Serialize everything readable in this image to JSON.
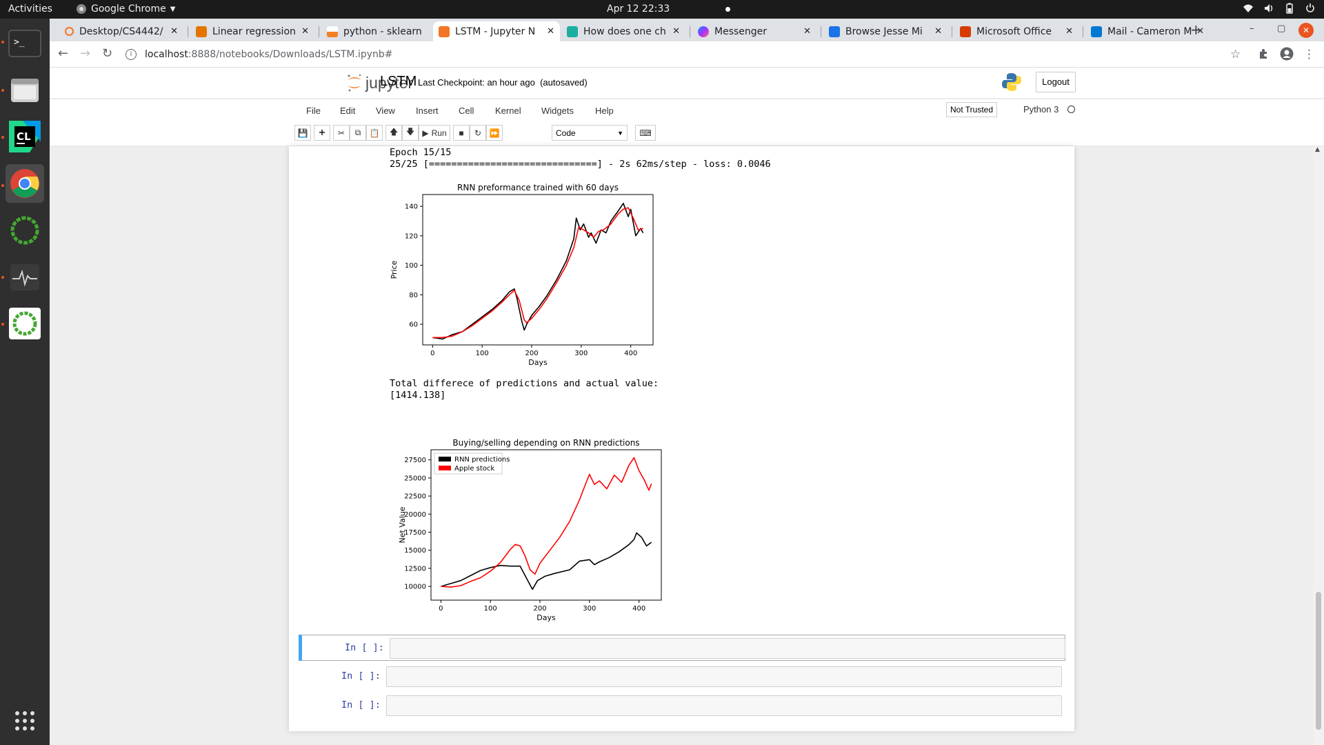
{
  "system_bar": {
    "activities": "Activities",
    "app_menu": "Google Chrome",
    "clock": "Apr 12  22:33",
    "tray_icons": [
      "wifi-icon",
      "volume-icon",
      "battery-icon",
      "power-menu-icon"
    ]
  },
  "dock": {
    "items": [
      {
        "name": "terminal",
        "running": true
      },
      {
        "name": "files",
        "running": true
      },
      {
        "name": "clion",
        "running": true
      },
      {
        "name": "chrome",
        "running": true,
        "active": true
      },
      {
        "name": "anaconda-navigator",
        "running": false
      },
      {
        "name": "system-monitor",
        "running": true
      },
      {
        "name": "anaconda",
        "running": true
      }
    ],
    "apps_grid": "show-applications-icon"
  },
  "browser": {
    "tabs": [
      {
        "label": "Desktop/CS4442/",
        "favicon": "jupyter",
        "color": "#f37626"
      },
      {
        "label": "Linear regression",
        "favicon": "doc",
        "color": "#e37400"
      },
      {
        "label": "python - sklearn",
        "favicon": "stackoverflow",
        "color": "#f48024"
      },
      {
        "label": "LSTM - Jupyter N",
        "favicon": "jupyter",
        "color": "#f37626",
        "active": true
      },
      {
        "label": "How does one ch",
        "favicon": "r",
        "color": "#1aafa0"
      },
      {
        "label": "Messenger",
        "favicon": "messenger",
        "color": "#a033ff"
      },
      {
        "label": "Browse Jesse Mi",
        "favicon": "bookmark",
        "color": "#1a73e8"
      },
      {
        "label": "Microsoft Office",
        "favicon": "office",
        "color": "#d83b01"
      },
      {
        "label": "Mail - Cameron M",
        "favicon": "outlook",
        "color": "#0078d4"
      }
    ],
    "url_host": "localhost",
    "url_path": ":8888/notebooks/Downloads/LSTM.ipynb#"
  },
  "jupyter": {
    "logo_text": "jupyter",
    "notebook_name": "LSTM",
    "checkpoint": "Last Checkpoint: an hour ago",
    "autosaved": "(autosaved)",
    "logout": "Logout",
    "menu": [
      "File",
      "Edit",
      "View",
      "Insert",
      "Cell",
      "Kernel",
      "Widgets",
      "Help"
    ],
    "trust": "Not Trusted",
    "kernel": "Python 3",
    "toolbar": {
      "run": "Run",
      "cell_type": "Code"
    }
  },
  "outputs": {
    "epoch_line": "Epoch 15/15",
    "progress_line": "25/25 [==============================] - 2s 62ms/step - loss: 0.0046",
    "diff_label": "Total differece of predictions and actual value:",
    "diff_value": "[1414.138]"
  },
  "cells": [
    {
      "prompt": "In [ ]:"
    },
    {
      "prompt": "In [ ]:"
    },
    {
      "prompt": "In [ ]:"
    }
  ],
  "chart_data": [
    {
      "type": "line",
      "title": "RNN preformance trained with 60 days",
      "xlabel": "Days",
      "ylabel": "Price",
      "xlim": [
        -20,
        445
      ],
      "ylim": [
        46,
        148
      ],
      "xticks": [
        0,
        100,
        200,
        300,
        400
      ],
      "yticks": [
        60,
        80,
        100,
        120,
        140
      ],
      "series": [
        {
          "color": "#000000",
          "x": [
            0,
            20,
            40,
            60,
            80,
            100,
            120,
            140,
            155,
            165,
            170,
            180,
            185,
            190,
            200,
            215,
            230,
            250,
            270,
            285,
            290,
            298,
            305,
            315,
            320,
            330,
            340,
            350,
            360,
            375,
            385,
            395,
            400,
            410,
            420,
            425
          ],
          "y": [
            51,
            50,
            53,
            55,
            60,
            65,
            70,
            76,
            82,
            84,
            78,
            62,
            56,
            60,
            66,
            72,
            79,
            90,
            103,
            118,
            132,
            124,
            128,
            119,
            122,
            115,
            124,
            122,
            130,
            137,
            142,
            133,
            138,
            120,
            125,
            122
          ]
        },
        {
          "color": "#ff0000",
          "x": [
            0,
            20,
            40,
            60,
            80,
            100,
            120,
            140,
            155,
            165,
            175,
            185,
            190,
            200,
            215,
            230,
            250,
            270,
            285,
            295,
            305,
            315,
            325,
            335,
            345,
            360,
            375,
            385,
            395,
            405,
            415,
            425
          ],
          "y": [
            51,
            51,
            52,
            55,
            59,
            64,
            69,
            75,
            80,
            83,
            76,
            63,
            61,
            64,
            70,
            77,
            88,
            100,
            112,
            126,
            124,
            122,
            119,
            123,
            124,
            128,
            135,
            138,
            139,
            132,
            124,
            125
          ]
        }
      ]
    },
    {
      "type": "line",
      "title": "Buying/selling depending on RNN predictions",
      "xlabel": "Days",
      "ylabel": "Net Value",
      "xlim": [
        -20,
        445
      ],
      "ylim": [
        8100,
        28900
      ],
      "xticks": [
        0,
        100,
        200,
        300,
        400
      ],
      "yticks": [
        10000,
        12500,
        15000,
        17500,
        20000,
        22500,
        25000,
        27500
      ],
      "legend": {
        "placement": "upper left",
        "entries": [
          "RNN predictions",
          "Apple stock"
        ]
      },
      "series": [
        {
          "name": "RNN predictions",
          "color": "#000000",
          "x": [
            0,
            20,
            40,
            60,
            80,
            100,
            120,
            140,
            160,
            170,
            180,
            185,
            195,
            210,
            230,
            260,
            280,
            300,
            310,
            320,
            340,
            360,
            380,
            390,
            395,
            405,
            415,
            425
          ],
          "y": [
            10000,
            10400,
            10800,
            11500,
            12200,
            12600,
            12900,
            12800,
            12800,
            11500,
            10200,
            9600,
            10800,
            11400,
            11800,
            12300,
            13500,
            13700,
            13000,
            13400,
            14000,
            14800,
            15800,
            16500,
            17400,
            16800,
            15600,
            16100
          ]
        },
        {
          "name": "Apple stock",
          "color": "#ff0000",
          "x": [
            0,
            20,
            40,
            60,
            80,
            100,
            120,
            140,
            150,
            160,
            170,
            180,
            190,
            200,
            220,
            240,
            260,
            280,
            290,
            300,
            310,
            320,
            335,
            350,
            365,
            380,
            390,
            400,
            410,
            420,
            425
          ],
          "y": [
            10000,
            9900,
            10100,
            10700,
            11200,
            12100,
            13300,
            15100,
            15800,
            15600,
            14200,
            12300,
            11700,
            13200,
            15000,
            16800,
            19000,
            22000,
            23800,
            25500,
            24100,
            24600,
            23500,
            25400,
            24400,
            26800,
            27800,
            26000,
            24800,
            23300,
            24200
          ]
        }
      ]
    }
  ]
}
